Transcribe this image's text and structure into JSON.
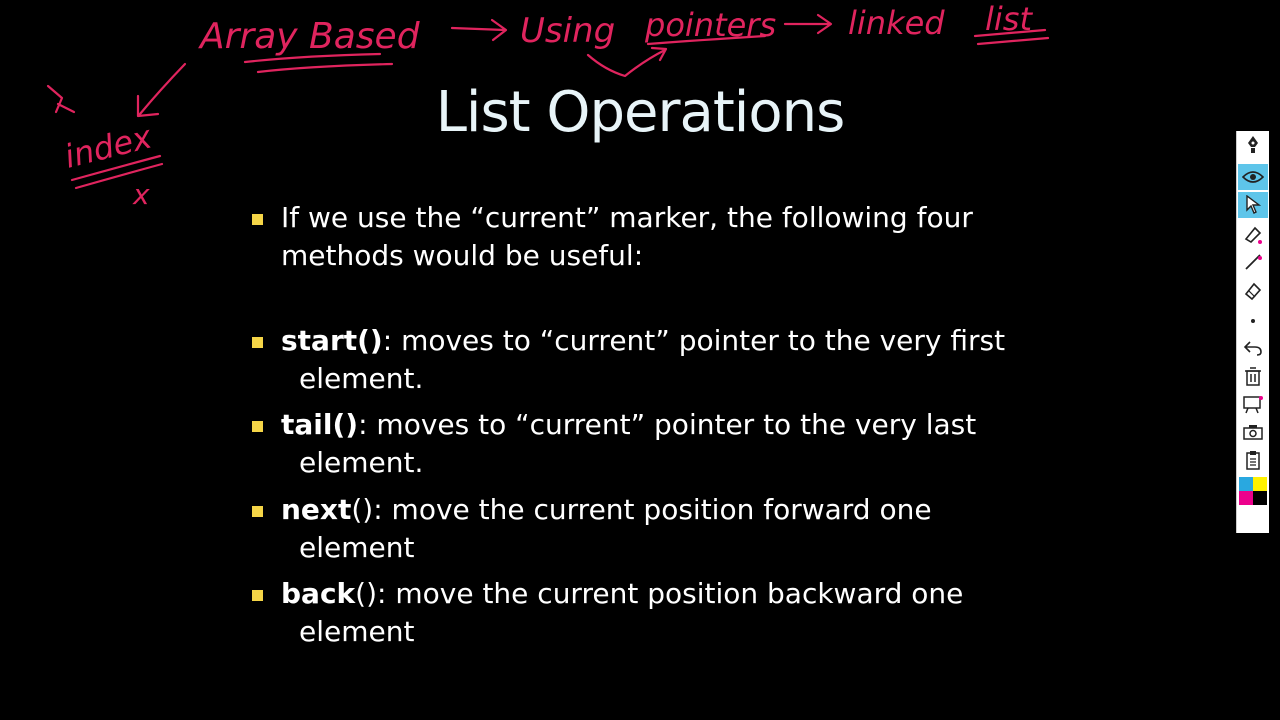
{
  "slide": {
    "title": "List Operations",
    "bullets": [
      {
        "line1": "If we use the “current” marker, the following four",
        "line2": "methods would be useful:"
      },
      {
        "bold": "start()",
        "rest": ": moves to “current” pointer to the very first",
        "line2": "element."
      },
      {
        "bold": "tail()",
        "rest": ": moves to “current” pointer to the very last",
        "line2": "element."
      },
      {
        "bold": "next",
        "rest": "(): move the current position forward one",
        "line2": "element"
      },
      {
        "bold": "back",
        "rest": "(): move the current position backward one",
        "line2": "element"
      }
    ]
  },
  "annotations": {
    "top_line": [
      "Array Based",
      "Using",
      "pointers",
      "linked",
      "list"
    ],
    "left": [
      "index",
      "x"
    ]
  },
  "toolbar": {
    "tools": [
      "pen-icon",
      "eye-icon",
      "pointer-icon",
      "highlighter-icon",
      "line-icon",
      "eraser-icon",
      "dot-icon",
      "undo-icon",
      "trash-icon",
      "whiteboard-icon",
      "camera-icon",
      "clipboard-icon"
    ],
    "swatches": [
      "#29a8e0",
      "#fff200",
      "#ec008c",
      "#000000"
    ]
  },
  "colors": {
    "ink": "#e0245e",
    "bullet": "#f5d547",
    "title": "#e8f4f8",
    "active_tool": "#5ec5ea"
  }
}
